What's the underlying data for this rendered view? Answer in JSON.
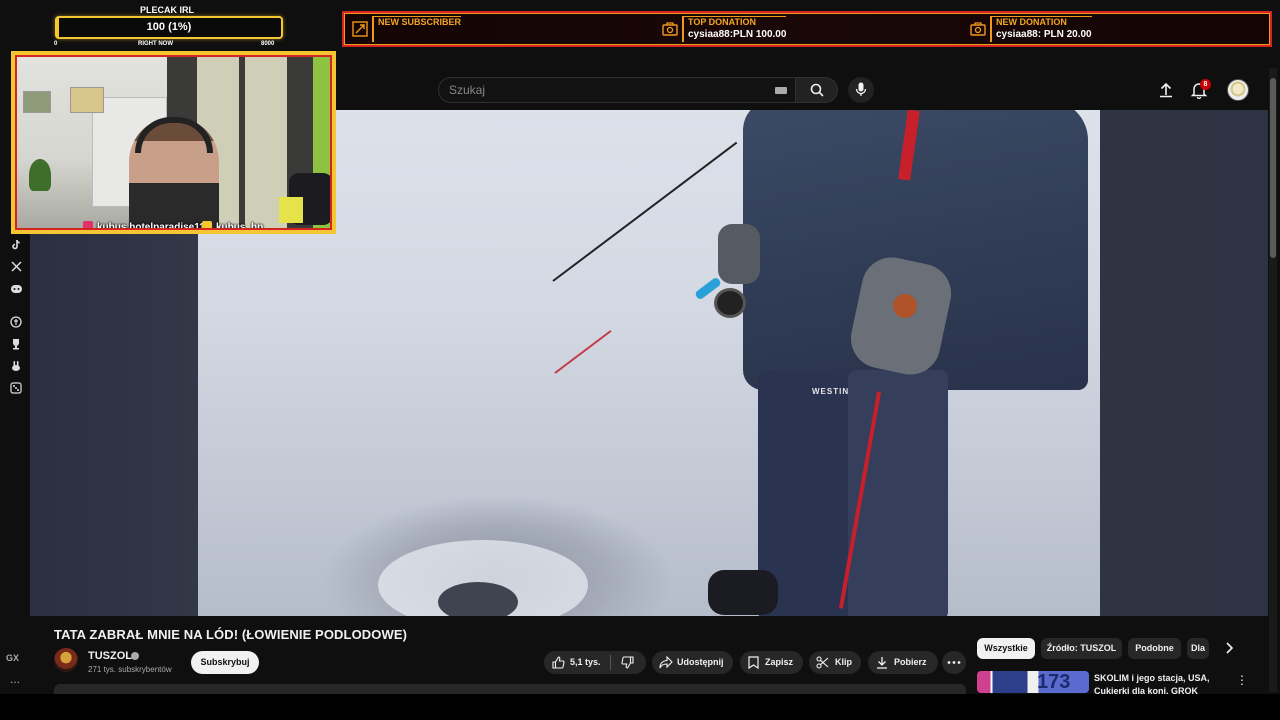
{
  "overlay": {
    "goal": {
      "title": "PLECAK IRL",
      "value_label": "100 (1%)",
      "progress_percent": 1,
      "min_label": "0",
      "mid_label": "RIGHT NOW",
      "max_label": "8000"
    },
    "alerts": [
      {
        "label": "NEW SUBSCRIBER",
        "value": ""
      },
      {
        "label": "TOP DONATION",
        "value": "cysiaa88:PLN 100.00"
      },
      {
        "label": "NEW DONATION",
        "value": "cysiaa88: PLN 20.00"
      }
    ],
    "socials": {
      "instagram": "kubus.hotelparadise11",
      "youtube": "kubus_hp"
    },
    "colors": {
      "gold": "#f4c632",
      "red": "#d42424",
      "orange": "#f09a1a"
    }
  },
  "header": {
    "search_placeholder": "Szukaj",
    "notification_count": "8"
  },
  "left_rail": {
    "icons": [
      "tiktok-icon",
      "x-icon",
      "discord-icon",
      "coin-icon",
      "trophy-icon",
      "rabbit-icon",
      "dice-icon"
    ],
    "bottom_label": "GX",
    "more_label": "..."
  },
  "video": {
    "title": "TATA ZABRAŁ MNIE NA LÓD! (ŁOWIENIE PODLODOWE)",
    "overlay_brand": "WESTIN"
  },
  "channel": {
    "name": "TUSZOL",
    "subscribers": "271 tys. subskrybentów",
    "subscribe_label": "Subskrybuj"
  },
  "actions": {
    "like_count": "5,1 tys.",
    "share": "Udostępnij",
    "save": "Zapisz",
    "clip": "Klip",
    "download": "Pobierz"
  },
  "chips": [
    "Wszystkie",
    "Źródło: TUSZOL",
    "Podobne",
    "Dla"
  ],
  "recommendation": {
    "thumb_text": "173",
    "title": "SKOLIM i jego stacja, USA, Cukierki dla koni, GROK"
  }
}
